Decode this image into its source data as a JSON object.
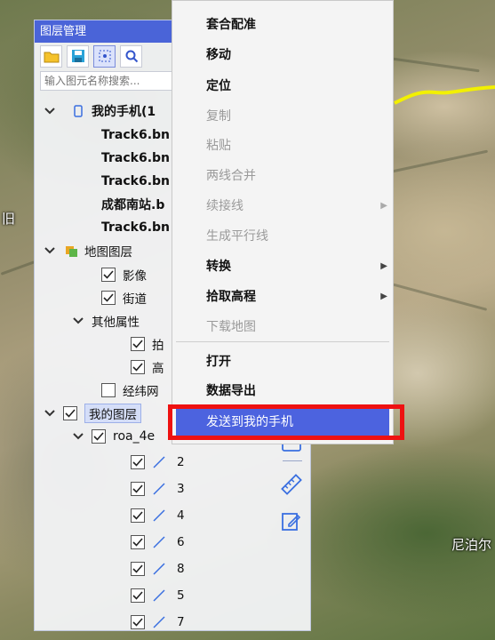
{
  "map": {
    "labels": [
      "旧",
      "尼泊尔"
    ],
    "road_color": "#f2f000"
  },
  "panel": {
    "title": "图层管理",
    "search_placeholder": "输入图元名称搜索...",
    "toolbar": [
      "folder-open-icon",
      "save-icon",
      "select-all-icon",
      "search-icon"
    ]
  },
  "tree": {
    "my_phone": "我的手机(1",
    "tracks": [
      "Track6.bn",
      "Track6.bn",
      "Track6.bn",
      "成都南站.b",
      "Track6.bn"
    ],
    "map_layers": "地图图层",
    "imagery": "影像",
    "streets": "街道",
    "other_props": "其他属性",
    "other_a": "拍",
    "other_b": "高",
    "graticule": "经纬网",
    "my_layers": "我的图层",
    "roa": "roa_4e",
    "children": [
      "2",
      "3",
      "4",
      "6",
      "8",
      "5",
      "7"
    ]
  },
  "menu": {
    "items": [
      {
        "label": "套合配准",
        "disabled": false,
        "submenu": false
      },
      {
        "label": "移动",
        "disabled": false,
        "submenu": false
      },
      {
        "label": "定位",
        "disabled": false,
        "submenu": false
      },
      {
        "label": "复制",
        "disabled": true,
        "submenu": false
      },
      {
        "label": "粘贴",
        "disabled": true,
        "submenu": false
      },
      {
        "label": "两线合并",
        "disabled": true,
        "submenu": false
      },
      {
        "label": "续接线",
        "disabled": true,
        "submenu": true
      },
      {
        "label": "生成平行线",
        "disabled": true,
        "submenu": false
      },
      {
        "label": "转换",
        "disabled": false,
        "submenu": true
      },
      {
        "label": "拾取高程",
        "disabled": false,
        "submenu": true
      },
      {
        "label": "下载地图",
        "disabled": true,
        "submenu": false
      },
      {
        "label": "打开",
        "disabled": false,
        "submenu": false
      },
      {
        "label": "数据导出",
        "disabled": false,
        "submenu": false
      }
    ],
    "send_to_phone": "发送到我的手机",
    "highlight_color": "#ee1111",
    "selected_color": "#4c63df"
  }
}
